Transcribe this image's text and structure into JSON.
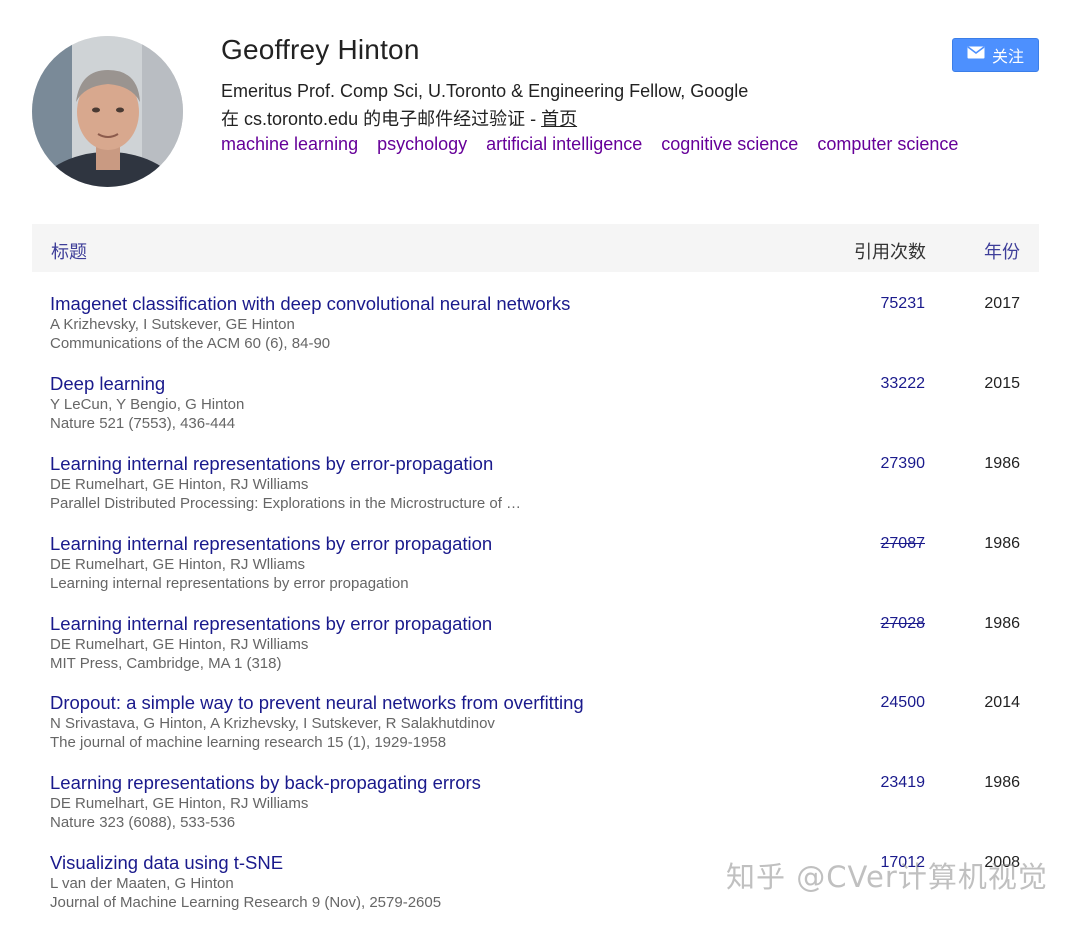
{
  "profile": {
    "name": "Geoffrey Hinton",
    "affiliation": "Emeritus Prof. Comp Sci, U.Toronto & Engineering Fellow, Google",
    "verified_text": "在 cs.toronto.edu 的电子邮件经过验证 - ",
    "homepage_label": "首页",
    "interests": [
      "machine learning",
      "psychology",
      "artificial intelligence",
      "cognitive science",
      "computer science"
    ],
    "follow_label": "关注"
  },
  "table": {
    "headers": {
      "title": "标题",
      "cited_by": "引用次数",
      "year": "年份"
    },
    "rows": [
      {
        "title": "Imagenet classification with deep convolutional neural networks",
        "authors": "A Krizhevsky, I Sutskever, GE Hinton",
        "venue": "Communications of the ACM 60 (6), 84-90",
        "cites": "75231",
        "year": "2017",
        "strike": false
      },
      {
        "title": "Deep learning",
        "authors": "Y LeCun, Y Bengio, G Hinton",
        "venue": "Nature 521 (7553), 436-444",
        "cites": "33222",
        "year": "2015",
        "strike": false
      },
      {
        "title": "Learning internal representations by error-propagation",
        "authors": "DE Rumelhart, GE Hinton, RJ Williams",
        "venue": "Parallel Distributed Processing: Explorations in the Microstructure of …",
        "cites": "27390",
        "year": "1986",
        "strike": false
      },
      {
        "title": "Learning internal representations by error propagation",
        "authors": "DE Rumelhart, GE Hinton, RJ Wlliams",
        "venue": "Learning internal representations by error propagation",
        "cites": "27087",
        "year": "1986",
        "strike": true
      },
      {
        "title": "Learning internal representations by error propagation",
        "authors": "DE Rumelhart, GE Hinton, RJ Williams",
        "venue": "MIT Press, Cambridge, MA 1 (318)",
        "cites": "27028",
        "year": "1986",
        "strike": true
      },
      {
        "title": "Dropout: a simple way to prevent neural networks from overfitting",
        "authors": "N Srivastava, G Hinton, A Krizhevsky, I Sutskever, R Salakhutdinov",
        "venue": "The journal of machine learning research 15 (1), 1929-1958",
        "cites": "24500",
        "year": "2014",
        "strike": false
      },
      {
        "title": "Learning representations by back-propagating errors",
        "authors": "DE Rumelhart, GE Hinton, RJ Williams",
        "venue": "Nature 323 (6088), 533-536",
        "cites": "23419",
        "year": "1986",
        "strike": false
      },
      {
        "title": "Visualizing data using t-SNE",
        "authors": "L van der Maaten, G Hinton",
        "venue": "Journal of Machine Learning Research 9 (Nov), 2579-2605",
        "cites": "17012",
        "year": "2008",
        "strike": false
      }
    ]
  },
  "watermark": "知乎 @CVer计算机视觉",
  "colors": {
    "link": "#1a1a8c",
    "interest": "#660099",
    "button": "#4d90fe",
    "header_bg": "#f5f5f5"
  },
  "icons": {
    "follow": "envelope-icon"
  }
}
